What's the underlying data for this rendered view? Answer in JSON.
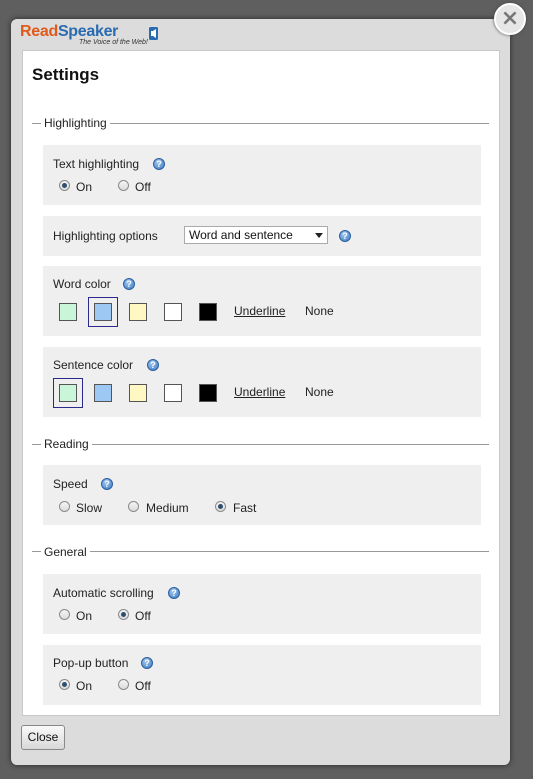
{
  "logo": {
    "brand_part1": "Read",
    "brand_part2": "Speaker",
    "tagline": "The Voice of the Web!"
  },
  "close_icon": "×",
  "title": "Settings",
  "highlighting": {
    "section_label": "Highlighting",
    "text_highlighting": {
      "label": "Text highlighting",
      "options": [
        "On",
        "Off"
      ],
      "selected": "On"
    },
    "highlighting_options": {
      "label": "Highlighting options",
      "value": "Word and sentence"
    },
    "word_color": {
      "label": "Word color",
      "swatches": [
        "#c9f5d9",
        "#9ec8f4",
        "#fff7c4",
        "#ffffff",
        "#000000"
      ],
      "selected_index": 1,
      "underline": "Underline",
      "none": "None"
    },
    "sentence_color": {
      "label": "Sentence color",
      "swatches": [
        "#c9f5d9",
        "#9ec8f4",
        "#fff7c4",
        "#ffffff",
        "#000000"
      ],
      "selected_index": 0,
      "underline": "Underline",
      "none": "None"
    }
  },
  "reading": {
    "section_label": "Reading",
    "speed": {
      "label": "Speed",
      "options": [
        "Slow",
        "Medium",
        "Fast"
      ],
      "selected": "Fast"
    }
  },
  "general": {
    "section_label": "General",
    "automatic_scrolling": {
      "label": "Automatic scrolling",
      "options": [
        "On",
        "Off"
      ],
      "selected": "Off"
    },
    "popup_button": {
      "label": "Pop-up button",
      "options": [
        "On",
        "Off"
      ],
      "selected": "On"
    }
  },
  "footer": {
    "close_label": "Close"
  },
  "colors": {
    "brand_orange": "#e05a1c",
    "brand_blue": "#2a6bb0",
    "help_blue": "#3b78c0"
  }
}
